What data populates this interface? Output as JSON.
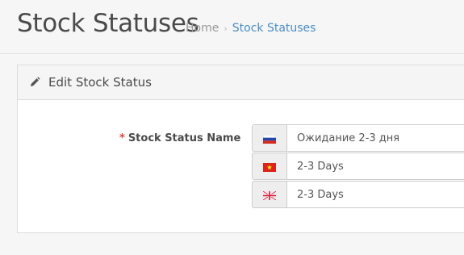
{
  "header": {
    "title": "Stock Statuses",
    "breadcrumb": {
      "home": "Home",
      "separator": "›",
      "current": "Stock Statuses"
    }
  },
  "panel": {
    "title": "Edit Stock Status",
    "icon": "pencil-icon"
  },
  "form": {
    "required_marker": "*",
    "label": "Stock Status Name",
    "fields": [
      {
        "language": "russian",
        "flag_icon": "russia-flag-icon",
        "value": "Ожидание 2-3 дня"
      },
      {
        "language": "vietnamese",
        "flag_icon": "vietnam-flag-icon",
        "value": "2-3 Days"
      },
      {
        "language": "english",
        "flag_icon": "uk-flag-icon",
        "value": "2-3 Days"
      }
    ]
  },
  "colors": {
    "link": "#4b8cc5",
    "required": "#e3403c",
    "border": "#cccccc"
  }
}
